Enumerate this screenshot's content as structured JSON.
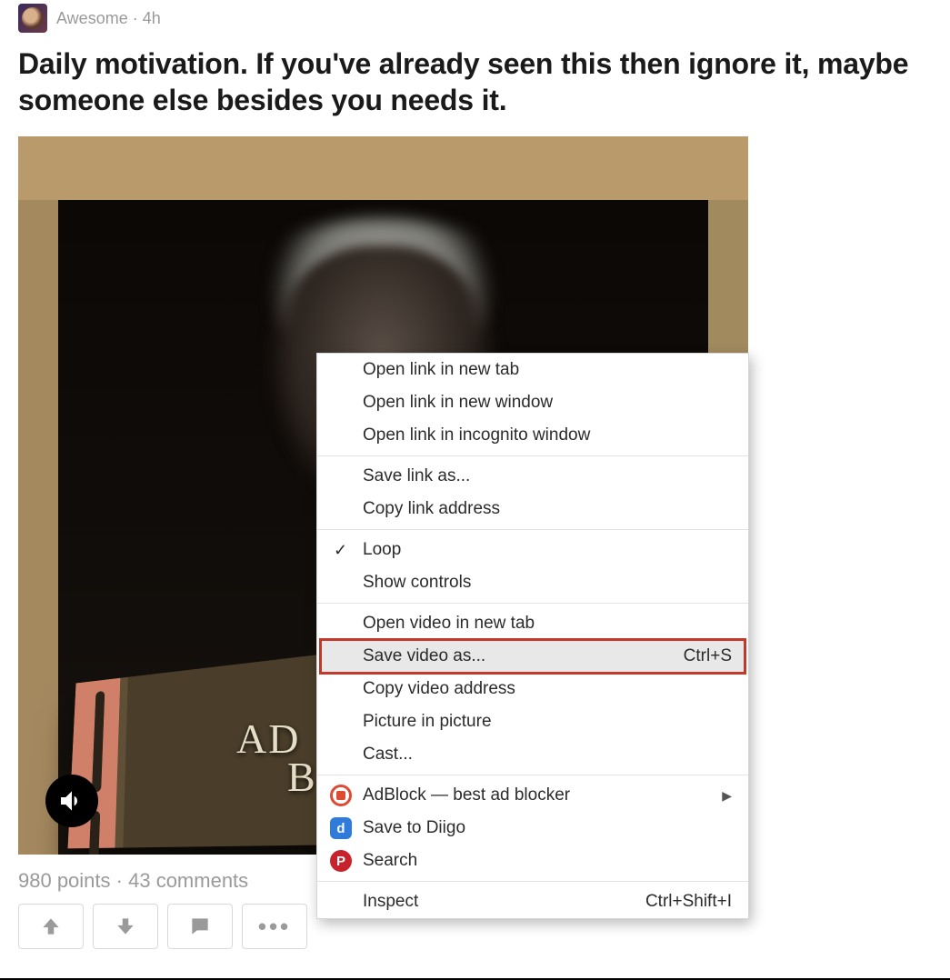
{
  "post": {
    "author": "Awesome",
    "age": "4h",
    "title": "Daily motivation. If you've already seen this then ignore it, maybe someone else besides you needs it.",
    "points": "980 points",
    "comments": "43 comments",
    "book_text_line1": "AD",
    "book_text_line2": "B"
  },
  "context_menu": {
    "open_new_tab": "Open link in new tab",
    "open_new_window": "Open link in new window",
    "open_incognito": "Open link in incognito window",
    "save_link": "Save link as...",
    "copy_link": "Copy link address",
    "loop": "Loop",
    "show_controls": "Show controls",
    "open_video": "Open video in new tab",
    "save_video": "Save video as...",
    "save_video_shortcut": "Ctrl+S",
    "copy_video": "Copy video address",
    "pip": "Picture in picture",
    "cast": "Cast...",
    "adblock": "AdBlock — best ad blocker",
    "diigo": "Save to Diigo",
    "diigo_icon_letter": "d",
    "search": "Search",
    "search_icon_letter": "P",
    "inspect": "Inspect",
    "inspect_shortcut": "Ctrl+Shift+I"
  }
}
